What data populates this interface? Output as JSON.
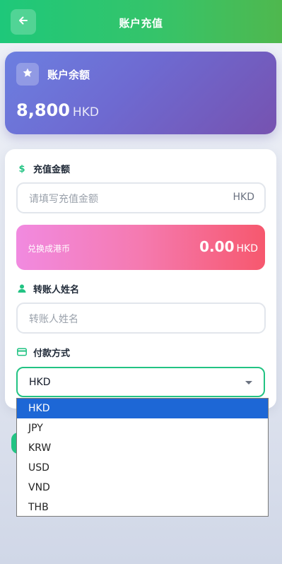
{
  "header": {
    "title": "账户充值",
    "back_icon": "arrow-left-icon",
    "gradient_start": "#1ec87a",
    "gradient_end": "#4fb84e"
  },
  "balance": {
    "title": "账户余额",
    "icon": "star-icon",
    "amount": "8,800",
    "currency": "HKD"
  },
  "recharge": {
    "amount_label": "充值金额",
    "amount_icon": "dollar-icon",
    "amount_placeholder": "请填写充值金额",
    "amount_suffix": "HKD",
    "convert_label": "兑换成港币",
    "convert_value": "0.00",
    "convert_currency": "HKD",
    "payer_label": "转账人姓名",
    "payer_icon": "person-icon",
    "payer_placeholder": "转账人姓名",
    "payment_label": "付款方式",
    "payment_icon": "credit-card-icon",
    "payment_selected": "HKD"
  },
  "dropdown": {
    "options": [
      "HKD",
      "JPY",
      "KRW",
      "USD",
      "VND",
      "THB"
    ],
    "selected_index": 0
  },
  "colors": {
    "accent": "#22c383",
    "balance_gradient_start": "#6c7fe0",
    "balance_gradient_end": "#7652b0",
    "convert_gradient_start": "#f18ae0",
    "convert_gradient_end": "#f6586e",
    "dropdown_highlight": "#1d67d6"
  }
}
